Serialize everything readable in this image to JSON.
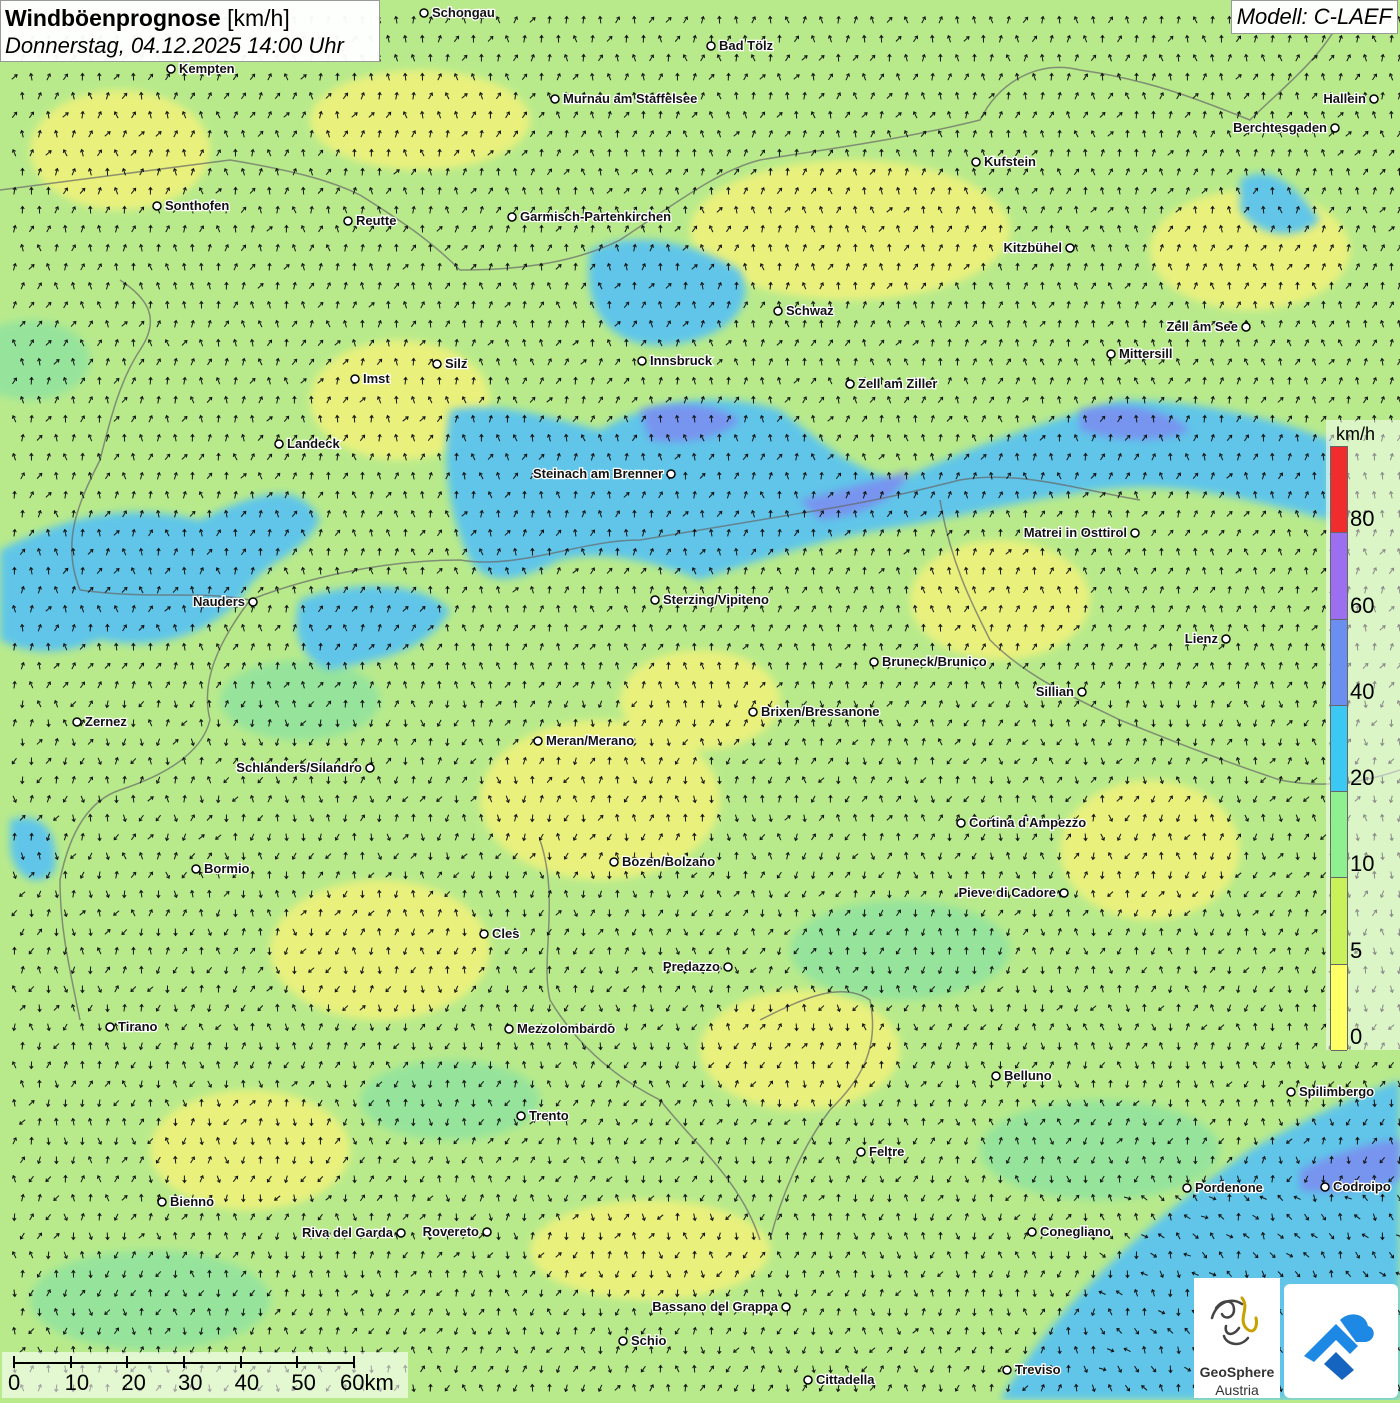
{
  "title": {
    "main": "Windböenprognose",
    "unit": "[km/h]",
    "datetime": "Donnerstag, 04.12.2025 14:00 Uhr"
  },
  "model": "Modell: C-LAEF",
  "legend": {
    "unit": "km/h",
    "labels": [
      "0",
      "5",
      "10",
      "20",
      "40",
      "60",
      "80"
    ],
    "colors": [
      "#ffff66",
      "#c9f25a",
      "#8ef08e",
      "#3bc9f3",
      "#6b8ff0",
      "#9b6ff0",
      "#f02c2c"
    ]
  },
  "scale_bar": {
    "labels": [
      "0",
      "10",
      "20",
      "30",
      "40",
      "50",
      "60km"
    ]
  },
  "logo": {
    "name": "GeoSphere",
    "sub": "Austria"
  },
  "cities": [
    {
      "name": "Schongau"
    },
    {
      "name": "Bad Tölz"
    },
    {
      "name": "Kempten"
    },
    {
      "name": "Murnau am Staffelsee"
    },
    {
      "name": "Hallein"
    },
    {
      "name": "Berchtesgaden"
    },
    {
      "name": "Kufstein"
    },
    {
      "name": "Sonthofen"
    },
    {
      "name": "Reutte"
    },
    {
      "name": "Garmisch-Partenkirchen"
    },
    {
      "name": "Kitzbühel"
    },
    {
      "name": "Schwaz"
    },
    {
      "name": "Zell am See"
    },
    {
      "name": "Innsbruck"
    },
    {
      "name": "Mittersill"
    },
    {
      "name": "Imst"
    },
    {
      "name": "Silz"
    },
    {
      "name": "Zell am Ziller"
    },
    {
      "name": "Landeck"
    },
    {
      "name": "Steinach am Brenner"
    },
    {
      "name": "Matrei in Osttirol"
    },
    {
      "name": "Nauders"
    },
    {
      "name": "Sterzing/Vipiteno"
    },
    {
      "name": "Lienz"
    },
    {
      "name": "Bruneck/Brunico"
    },
    {
      "name": "Sillian"
    },
    {
      "name": "Zernez"
    },
    {
      "name": "Brixen/Bressanone"
    },
    {
      "name": "Meran/Merano"
    },
    {
      "name": "Schlanders/Silandro"
    },
    {
      "name": "Cortina d'Ampezzo"
    },
    {
      "name": "Bozen/Bolzano"
    },
    {
      "name": "Bormio"
    },
    {
      "name": "Pieve di Cadore"
    },
    {
      "name": "Cles"
    },
    {
      "name": "Predazzo"
    },
    {
      "name": "Tirano"
    },
    {
      "name": "Mezzolombardo"
    },
    {
      "name": "Belluno"
    },
    {
      "name": "Spilimbergo"
    },
    {
      "name": "Trento"
    },
    {
      "name": "Feltre"
    },
    {
      "name": "Pordenone"
    },
    {
      "name": "Codroipo"
    },
    {
      "name": "Bienno"
    },
    {
      "name": "Riva del Garda"
    },
    {
      "name": "Rovereto"
    },
    {
      "name": "Conegliano"
    },
    {
      "name": "Bassano del Grappa"
    },
    {
      "name": "Schio"
    },
    {
      "name": "Treviso"
    },
    {
      "name": "Cittadella"
    }
  ]
}
